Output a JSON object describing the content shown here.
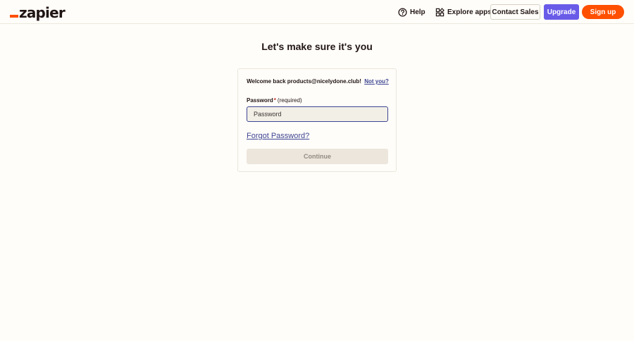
{
  "header": {
    "logo_text": "zapier",
    "help_label": "Help",
    "explore_label": "Explore apps",
    "contact_label": "Contact Sales",
    "upgrade_label": "Upgrade",
    "signup_label": "Sign up"
  },
  "main": {
    "title": "Let's make sure it's you",
    "welcome_text": "Welcome back products@nicelydone.club!",
    "not_you_label": "Not you?",
    "password_label": "Password",
    "required_mark": "*",
    "required_text": "(required)",
    "password_placeholder": "Password",
    "password_value": "",
    "forgot_label": "Forgot Password?",
    "continue_label": "Continue"
  },
  "icons": {
    "help": "help-circle-icon",
    "explore": "grid-apps-icon"
  },
  "colors": {
    "brand_orange": "#ff4f00",
    "upgrade_purple": "#695be8",
    "link_blue": "#3d4592",
    "background": "#fffdf9"
  }
}
